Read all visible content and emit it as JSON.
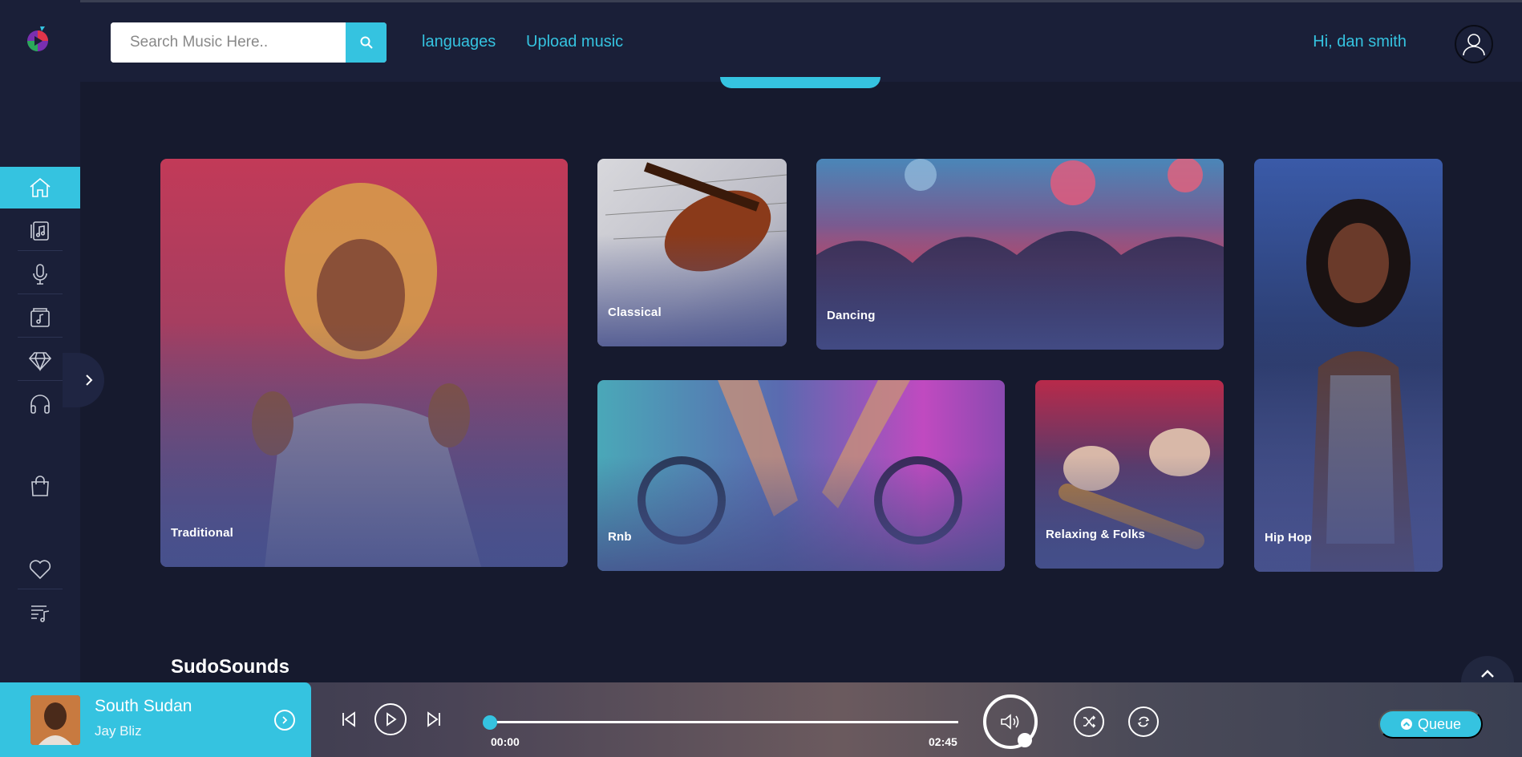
{
  "header": {
    "search_placeholder": "Search Music Here..",
    "nav_languages": "languages",
    "nav_upload": "Upload music",
    "greeting": "Hi, dan smith"
  },
  "sidebar": {
    "items": [
      {
        "icon": "home-icon",
        "active": true
      },
      {
        "icon": "music-albums-icon",
        "active": false
      },
      {
        "icon": "microphone-icon",
        "active": false
      },
      {
        "icon": "music-folder-icon",
        "active": false
      },
      {
        "icon": "diamond-icon",
        "active": false
      },
      {
        "icon": "headphones-icon",
        "active": false
      },
      {
        "icon": "shopping-bag-icon",
        "active": false
      },
      {
        "icon": "heart-icon",
        "active": false
      },
      {
        "icon": "playlist-icon",
        "active": false
      }
    ]
  },
  "genres": [
    {
      "label": "Traditional"
    },
    {
      "label": "Classical"
    },
    {
      "label": "Dancing"
    },
    {
      "label": "Hip Hop"
    },
    {
      "label": "Rnb"
    },
    {
      "label": "Relaxing & Folks"
    }
  ],
  "section": {
    "title": "SudoSounds"
  },
  "player": {
    "track_title": "South Sudan",
    "artist": "Jay Bliz",
    "time_current": "00:00",
    "time_total": "02:45",
    "progress": 0,
    "queue_label": "Queue"
  },
  "colors": {
    "accent": "#35c3e0",
    "background": "#161a2e",
    "sidebar": "#1a1f38"
  }
}
